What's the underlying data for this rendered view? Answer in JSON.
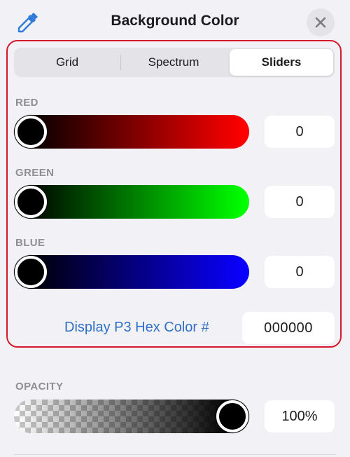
{
  "header": {
    "title": "Background Color",
    "eyedropper_icon": "eyedropper-icon",
    "close_icon": "close-icon"
  },
  "tabs": [
    {
      "label": "Grid",
      "active": false
    },
    {
      "label": "Spectrum",
      "active": false
    },
    {
      "label": "Sliders",
      "active": true
    }
  ],
  "sliders": {
    "red": {
      "label": "RED",
      "value": "0",
      "fraction": 0.0,
      "color": "#ff0000"
    },
    "green": {
      "label": "GREEN",
      "value": "0",
      "fraction": 0.0,
      "color": "#00ff00"
    },
    "blue": {
      "label": "BLUE",
      "value": "0",
      "fraction": 0.0,
      "color": "#0a00ff"
    }
  },
  "hex": {
    "label": "Display P3 Hex Color #",
    "value": "000000"
  },
  "opacity": {
    "label": "OPACITY",
    "value": "100%",
    "fraction": 1.0
  },
  "colors": {
    "accent_link": "#2f6fc5",
    "highlight_border": "#d61a2c"
  }
}
